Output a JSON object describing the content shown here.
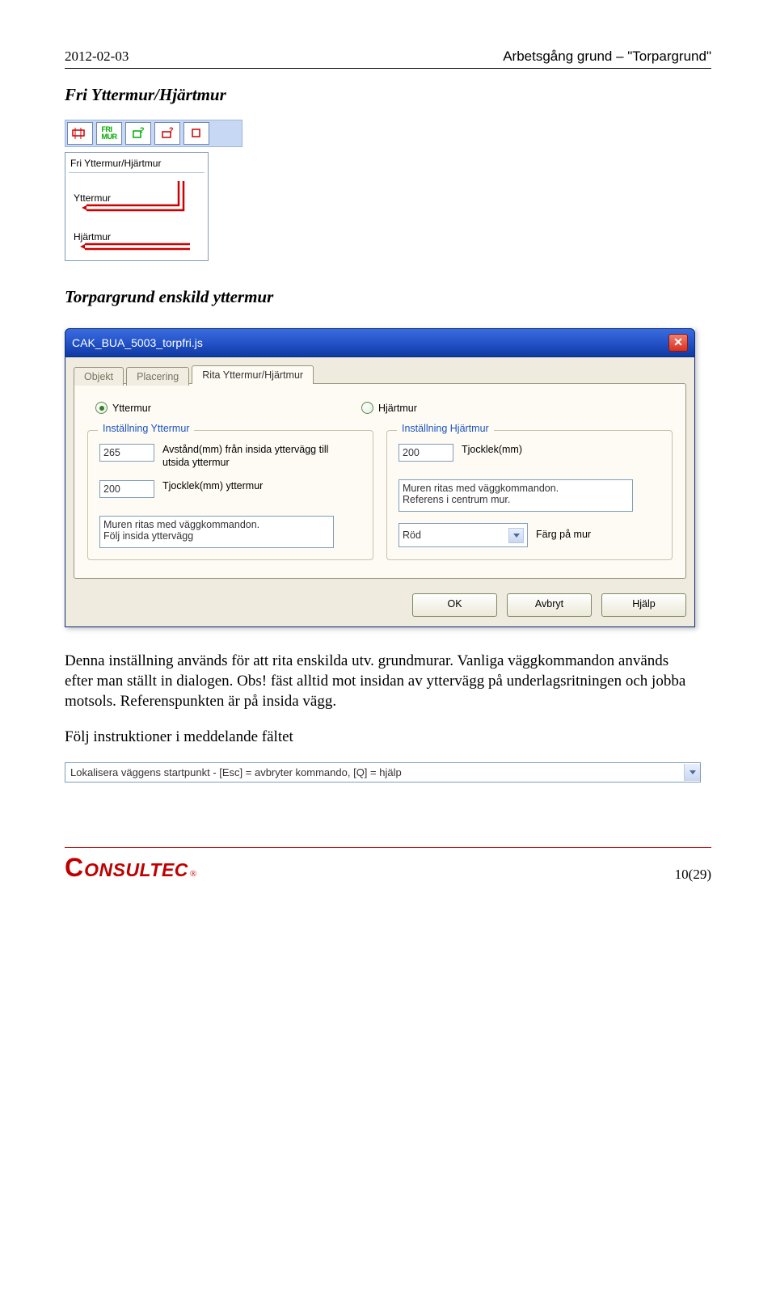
{
  "header": {
    "date": "2012-02-03",
    "doc_title": "Arbetsgång grund – \"Torpargrund\""
  },
  "section1_title": "Fri Yttermur/Hjärtmur",
  "toolbar": {
    "btn_fri": "FRI\nMUR",
    "dropdown_title": "Fri Yttermur/Hjärtmur",
    "shape1": "Yttermur",
    "shape2": "Hjärtmur"
  },
  "section2_title": "Torpargrund enskild yttermur",
  "dialog": {
    "title": "CAK_BUA_5003_torpfri.js",
    "tabs": [
      "Objekt",
      "Placering",
      "Rita Yttermur/Hjärtmur"
    ],
    "radio_yt": "Yttermur",
    "radio_hj": "Hjärtmur",
    "group_y": {
      "legend": "Inställning Yttermur",
      "v1": "265",
      "l1": "Avstånd(mm) från insida yttervägg till utsida yttermur",
      "v2": "200",
      "l2": "Tjocklek(mm) yttermur",
      "note": "Muren ritas med väggkommandon.\nFölj insida yttervägg"
    },
    "group_h": {
      "legend": "Inställning Hjärtmur",
      "v1": "200",
      "l1": "Tjocklek(mm)",
      "note": "Muren ritas med väggkommandon.\nReferens i centrum mur.",
      "color_value": "Röd",
      "color_label": "Färg på mur"
    },
    "btn_ok": "OK",
    "btn_cancel": "Avbryt",
    "btn_help": "Hjälp"
  },
  "paragraph": "Denna inställning används för att rita enskilda utv. grundmurar. Vanliga väggkommandon används efter man ställt in dialogen. Obs! fäst alltid mot insidan av yttervägg på underlagsritningen och jobba motsols. Referenspunkten är på insida vägg.",
  "paragraph2": "Följ instruktioner i meddelande fältet",
  "statusbar": "Lokalisera väggens startpunkt - [Esc] = avbryter kommando, [Q] = hjälp",
  "footer": {
    "logo_c": "C",
    "logo_rest": "ONSULTEC",
    "reg": "®",
    "page": "10(29)"
  }
}
